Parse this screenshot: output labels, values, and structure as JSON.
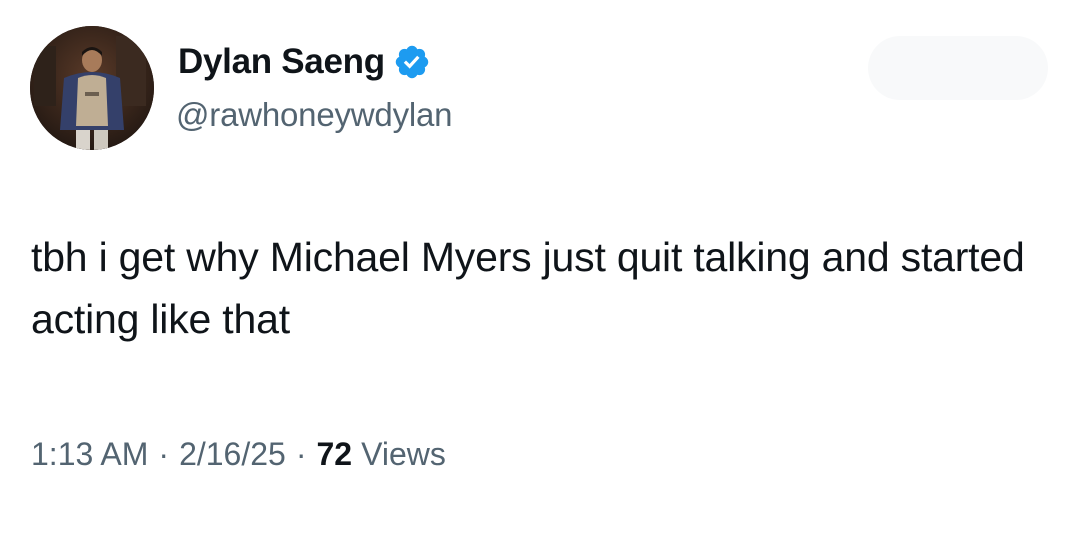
{
  "author": {
    "display_name": "Dylan Saeng",
    "handle": "@rawhoneywdylan",
    "verified": true,
    "avatar": "profile-photo",
    "verified_icon": "verified-badge-icon",
    "verified_color": "#1d9bf0"
  },
  "tweet": {
    "text": "tbh i get why Michael Myers just quit talking and started acting like that"
  },
  "meta": {
    "time": "1:13 AM",
    "date": "2/16/25",
    "separator": "·",
    "views_count": "72",
    "views_label": "Views"
  },
  "colors": {
    "text_primary": "#0f1419",
    "text_secondary": "#536471",
    "background": "#ffffff"
  }
}
